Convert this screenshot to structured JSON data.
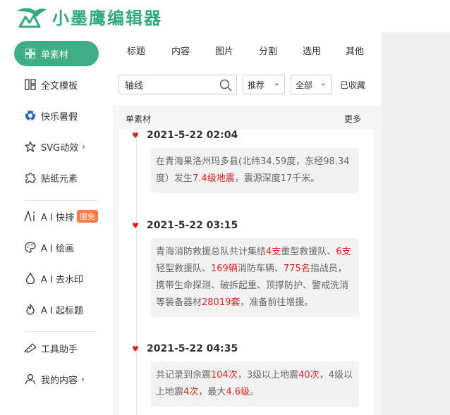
{
  "app": {
    "name": "小墨鹰编辑器",
    "accent": "#3fae86",
    "logo_color": "#2fa97e"
  },
  "sidebar": {
    "items": [
      {
        "label": "单素材",
        "icon": "grid-icon",
        "active": true
      },
      {
        "label": "全文模板",
        "icon": "template-icon"
      },
      {
        "label": "快乐暑假",
        "icon": "football-icon"
      },
      {
        "label": "SVG动效",
        "icon": "star-icon",
        "arrow": "›"
      },
      {
        "label": "贴纸元素",
        "icon": "puzzle-icon"
      },
      {
        "label": "A I 快排",
        "icon": "ai-icon",
        "badge": "限免"
      },
      {
        "label": "A I 绘画",
        "icon": "palette-icon"
      },
      {
        "label": "A I 去水印",
        "icon": "drop-icon"
      },
      {
        "label": "A I 起标题",
        "icon": "flame-icon"
      },
      {
        "label": "工具助手",
        "icon": "ruler-icon"
      },
      {
        "label": "我的内容",
        "icon": "user-icon",
        "arrow": "›"
      }
    ]
  },
  "tabs": [
    "标题",
    "内容",
    "图片",
    "分割",
    "选用",
    "其他"
  ],
  "search": {
    "value": "轴线",
    "placeholder": ""
  },
  "filters": {
    "sort": "推荐",
    "scope": "全部",
    "favorites": "已收藏"
  },
  "list": {
    "title": "单素材",
    "more": "更多"
  },
  "timeline": [
    {
      "date": "2021-5-22 02:04",
      "parts": [
        {
          "t": "在青海果洛州玛多县(北纬34.59度，东经98.34度）发生"
        },
        {
          "t": "7.4级地震",
          "hl": true
        },
        {
          "t": "，震源深度17千米。"
        }
      ]
    },
    {
      "date": "2021-5-22 03:15",
      "parts": [
        {
          "t": "青海消防救援总队共计集结"
        },
        {
          "t": "4支",
          "hl": true
        },
        {
          "t": "重型救援队、"
        },
        {
          "t": "6支",
          "hl": true
        },
        {
          "t": "轻型救援队、"
        },
        {
          "t": "169辆",
          "hl": true
        },
        {
          "t": "消防车辆、"
        },
        {
          "t": "775名",
          "hl": true
        },
        {
          "t": "指战员，携带生命探测、破拆起重、顶撑防护、警戒洗消等装备器材"
        },
        {
          "t": "28019套",
          "hl": true
        },
        {
          "t": "，准备前往增援。"
        }
      ]
    },
    {
      "date": "2021-5-22 04:35",
      "parts": [
        {
          "t": "共记录到余震"
        },
        {
          "t": "104次",
          "hl": true
        },
        {
          "t": "，3级以上地震"
        },
        {
          "t": "40次",
          "hl": true
        },
        {
          "t": "，4级以上地震"
        },
        {
          "t": "4次",
          "hl": true
        },
        {
          "t": "，最大"
        },
        {
          "t": "4.6级",
          "hl": true
        },
        {
          "t": "。"
        }
      ]
    }
  ],
  "colors": {
    "highlight": "#e02020",
    "heart": "#e02020"
  }
}
